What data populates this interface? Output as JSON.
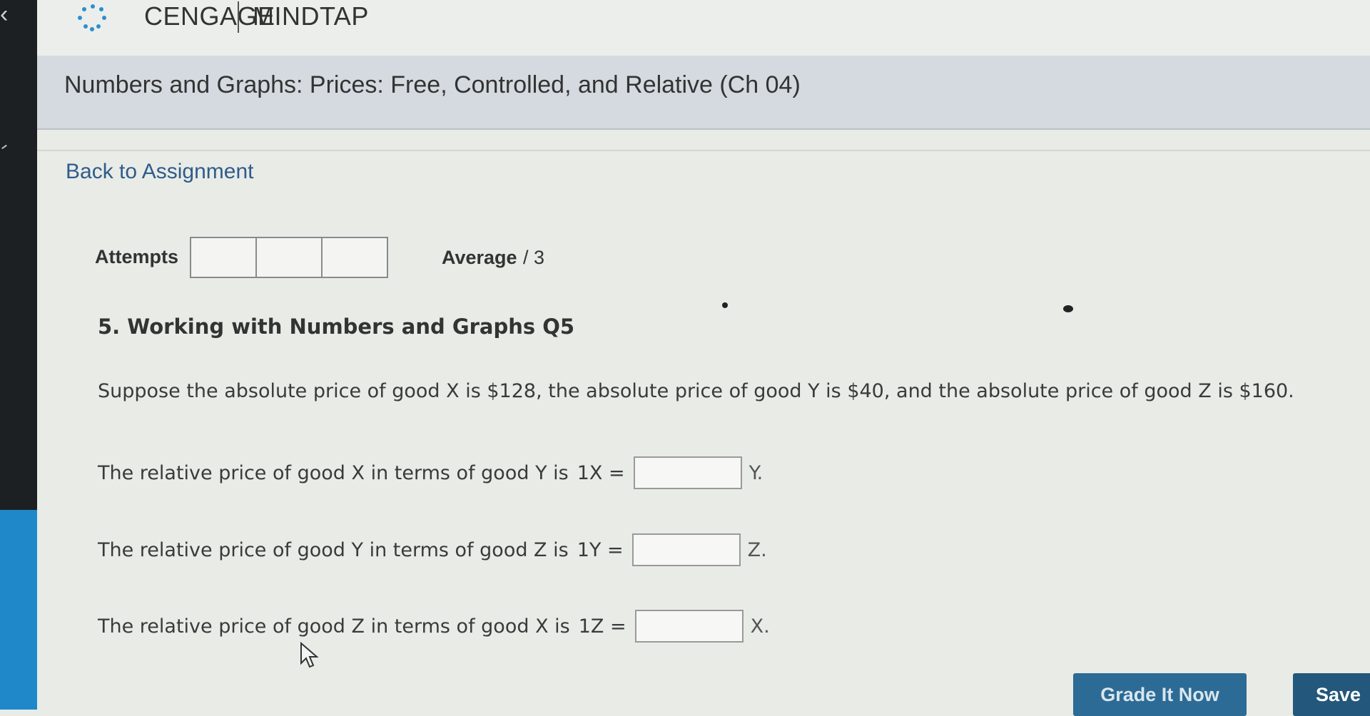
{
  "header": {
    "brand": "CENGAGE",
    "product": "MINDTAP",
    "logo_icon": "cengage-logo-icon",
    "back_icon": "chevron-left-icon"
  },
  "page_title": "Numbers and Graphs: Prices: Free, Controlled, and Relative (Ch 04)",
  "back_link": "Back to Assignment",
  "attempts": {
    "label": "Attempts",
    "boxes": [
      "",
      "",
      ""
    ],
    "average_label": "Average",
    "average_total": "/ 3"
  },
  "question": {
    "title": "5. Working with Numbers and Graphs Q5",
    "prompt": "Suppose the absolute price of good X is $128, the absolute price of good Y is $40, and the absolute price of good Z is $160.",
    "items": [
      {
        "text": "The relative price of good X in terms of good Y is",
        "equation": "1X =",
        "value": "",
        "unit": "Y."
      },
      {
        "text": "The relative price of good Y in terms of good Z is",
        "equation": "1Y =",
        "value": "",
        "unit": "Z."
      },
      {
        "text": "The relative price of good Z in terms of good X is",
        "equation": "1Z =",
        "value": "",
        "unit": "X."
      }
    ]
  },
  "buttons": {
    "grade": "Grade It Now",
    "save": "Save"
  },
  "colors": {
    "rail": "#1d2023",
    "rail_accent": "#1f88c9",
    "link": "#2f5c8a",
    "button": "#2c6b95"
  }
}
